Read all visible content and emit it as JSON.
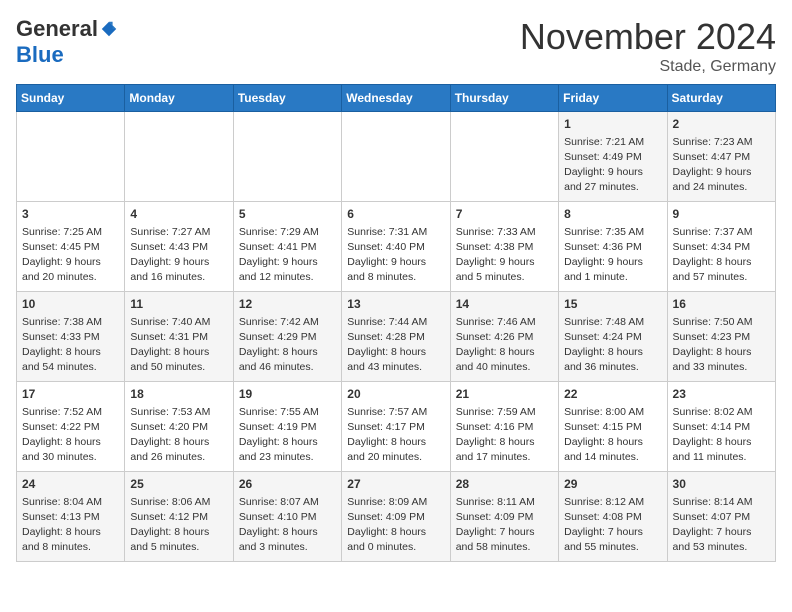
{
  "logo": {
    "general": "General",
    "blue": "Blue"
  },
  "header": {
    "month": "November 2024",
    "location": "Stade, Germany"
  },
  "weekdays": [
    "Sunday",
    "Monday",
    "Tuesday",
    "Wednesday",
    "Thursday",
    "Friday",
    "Saturday"
  ],
  "weeks": [
    [
      {
        "day": "",
        "info": ""
      },
      {
        "day": "",
        "info": ""
      },
      {
        "day": "",
        "info": ""
      },
      {
        "day": "",
        "info": ""
      },
      {
        "day": "",
        "info": ""
      },
      {
        "day": "1",
        "info": "Sunrise: 7:21 AM\nSunset: 4:49 PM\nDaylight: 9 hours\nand 27 minutes."
      },
      {
        "day": "2",
        "info": "Sunrise: 7:23 AM\nSunset: 4:47 PM\nDaylight: 9 hours\nand 24 minutes."
      }
    ],
    [
      {
        "day": "3",
        "info": "Sunrise: 7:25 AM\nSunset: 4:45 PM\nDaylight: 9 hours\nand 20 minutes."
      },
      {
        "day": "4",
        "info": "Sunrise: 7:27 AM\nSunset: 4:43 PM\nDaylight: 9 hours\nand 16 minutes."
      },
      {
        "day": "5",
        "info": "Sunrise: 7:29 AM\nSunset: 4:41 PM\nDaylight: 9 hours\nand 12 minutes."
      },
      {
        "day": "6",
        "info": "Sunrise: 7:31 AM\nSunset: 4:40 PM\nDaylight: 9 hours\nand 8 minutes."
      },
      {
        "day": "7",
        "info": "Sunrise: 7:33 AM\nSunset: 4:38 PM\nDaylight: 9 hours\nand 5 minutes."
      },
      {
        "day": "8",
        "info": "Sunrise: 7:35 AM\nSunset: 4:36 PM\nDaylight: 9 hours\nand 1 minute."
      },
      {
        "day": "9",
        "info": "Sunrise: 7:37 AM\nSunset: 4:34 PM\nDaylight: 8 hours\nand 57 minutes."
      }
    ],
    [
      {
        "day": "10",
        "info": "Sunrise: 7:38 AM\nSunset: 4:33 PM\nDaylight: 8 hours\nand 54 minutes."
      },
      {
        "day": "11",
        "info": "Sunrise: 7:40 AM\nSunset: 4:31 PM\nDaylight: 8 hours\nand 50 minutes."
      },
      {
        "day": "12",
        "info": "Sunrise: 7:42 AM\nSunset: 4:29 PM\nDaylight: 8 hours\nand 46 minutes."
      },
      {
        "day": "13",
        "info": "Sunrise: 7:44 AM\nSunset: 4:28 PM\nDaylight: 8 hours\nand 43 minutes."
      },
      {
        "day": "14",
        "info": "Sunrise: 7:46 AM\nSunset: 4:26 PM\nDaylight: 8 hours\nand 40 minutes."
      },
      {
        "day": "15",
        "info": "Sunrise: 7:48 AM\nSunset: 4:24 PM\nDaylight: 8 hours\nand 36 minutes."
      },
      {
        "day": "16",
        "info": "Sunrise: 7:50 AM\nSunset: 4:23 PM\nDaylight: 8 hours\nand 33 minutes."
      }
    ],
    [
      {
        "day": "17",
        "info": "Sunrise: 7:52 AM\nSunset: 4:22 PM\nDaylight: 8 hours\nand 30 minutes."
      },
      {
        "day": "18",
        "info": "Sunrise: 7:53 AM\nSunset: 4:20 PM\nDaylight: 8 hours\nand 26 minutes."
      },
      {
        "day": "19",
        "info": "Sunrise: 7:55 AM\nSunset: 4:19 PM\nDaylight: 8 hours\nand 23 minutes."
      },
      {
        "day": "20",
        "info": "Sunrise: 7:57 AM\nSunset: 4:17 PM\nDaylight: 8 hours\nand 20 minutes."
      },
      {
        "day": "21",
        "info": "Sunrise: 7:59 AM\nSunset: 4:16 PM\nDaylight: 8 hours\nand 17 minutes."
      },
      {
        "day": "22",
        "info": "Sunrise: 8:00 AM\nSunset: 4:15 PM\nDaylight: 8 hours\nand 14 minutes."
      },
      {
        "day": "23",
        "info": "Sunrise: 8:02 AM\nSunset: 4:14 PM\nDaylight: 8 hours\nand 11 minutes."
      }
    ],
    [
      {
        "day": "24",
        "info": "Sunrise: 8:04 AM\nSunset: 4:13 PM\nDaylight: 8 hours\nand 8 minutes."
      },
      {
        "day": "25",
        "info": "Sunrise: 8:06 AM\nSunset: 4:12 PM\nDaylight: 8 hours\nand 5 minutes."
      },
      {
        "day": "26",
        "info": "Sunrise: 8:07 AM\nSunset: 4:10 PM\nDaylight: 8 hours\nand 3 minutes."
      },
      {
        "day": "27",
        "info": "Sunrise: 8:09 AM\nSunset: 4:09 PM\nDaylight: 8 hours\nand 0 minutes."
      },
      {
        "day": "28",
        "info": "Sunrise: 8:11 AM\nSunset: 4:09 PM\nDaylight: 7 hours\nand 58 minutes."
      },
      {
        "day": "29",
        "info": "Sunrise: 8:12 AM\nSunset: 4:08 PM\nDaylight: 7 hours\nand 55 minutes."
      },
      {
        "day": "30",
        "info": "Sunrise: 8:14 AM\nSunset: 4:07 PM\nDaylight: 7 hours\nand 53 minutes."
      }
    ]
  ]
}
